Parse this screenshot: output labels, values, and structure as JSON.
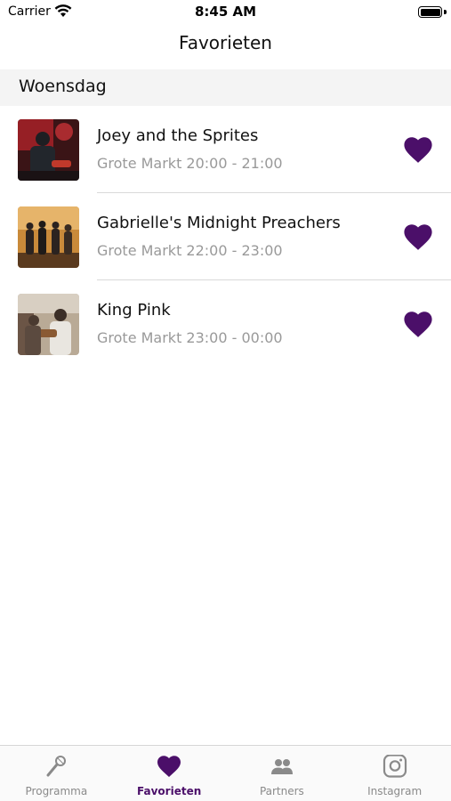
{
  "status_bar": {
    "carrier": "Carrier",
    "time": "8:45 AM",
    "wifi_icon": "wifi-icon",
    "battery_icon": "battery-icon"
  },
  "nav": {
    "title": "Favorieten"
  },
  "section": {
    "title": "Woensdag"
  },
  "favorites": [
    {
      "name": "Joey and the Sprites",
      "time": "Grote Markt 20:00 - 21:00",
      "favorited": true
    },
    {
      "name": "Gabrielle's Midnight Preachers",
      "time": "Grote Markt 22:00 - 23:00",
      "favorited": true
    },
    {
      "name": "King Pink",
      "time": "Grote Markt 23:00 - 00:00",
      "favorited": true
    }
  ],
  "tab_bar": {
    "tabs": [
      {
        "label": "Programma",
        "icon": "microphone-icon",
        "active": false
      },
      {
        "label": "Favorieten",
        "icon": "heart-icon",
        "active": true
      },
      {
        "label": "Partners",
        "icon": "people-icon",
        "active": false
      },
      {
        "label": "Instagram",
        "icon": "instagram-icon",
        "active": false
      }
    ]
  },
  "colors": {
    "accent": "#4b0f69",
    "inactive_tab": "#8a8a8a",
    "section_background": "#f4f4f4",
    "secondary_text": "#999999"
  }
}
